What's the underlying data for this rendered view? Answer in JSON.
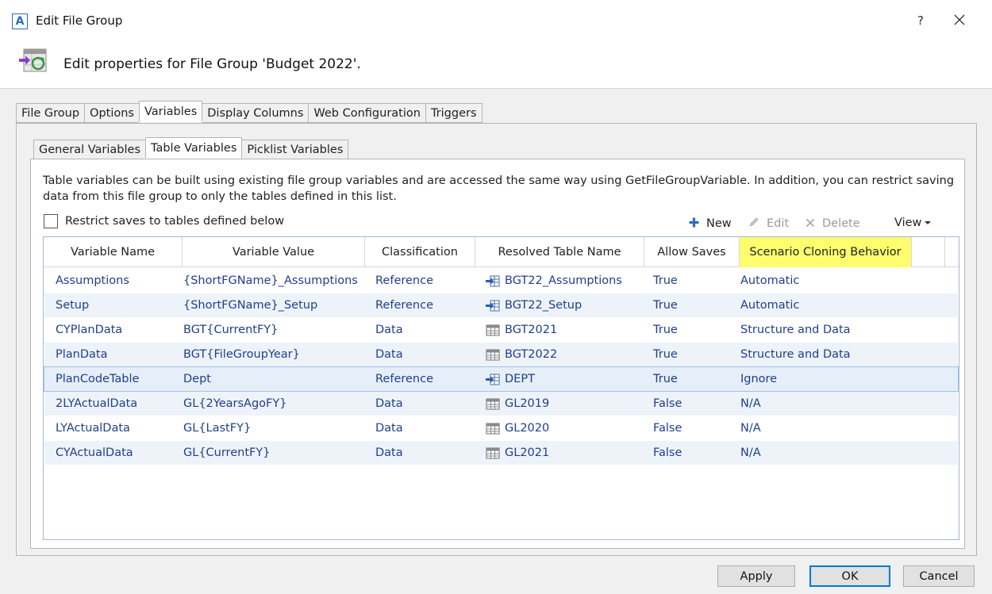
{
  "window": {
    "title": "Edit File Group",
    "app_icon_letter": "A",
    "help_label": "?"
  },
  "header": {
    "text": "Edit properties for File Group 'Budget 2022'."
  },
  "tabs": [
    {
      "label": "File Group",
      "active": false
    },
    {
      "label": "Options",
      "active": false
    },
    {
      "label": "Variables",
      "active": true
    },
    {
      "label": "Display Columns",
      "active": false
    },
    {
      "label": "Web Configuration",
      "active": false
    },
    {
      "label": "Triggers",
      "active": false
    }
  ],
  "subtabs": [
    {
      "label": "General Variables",
      "active": false
    },
    {
      "label": "Table Variables",
      "active": true
    },
    {
      "label": "Picklist Variables",
      "active": false
    }
  ],
  "description": "Table variables can be built using existing file group variables and are accessed the same way using GetFileGroupVariable. In addition, you can restrict saving data from this file group to only the tables defined in this list.",
  "restrict_label": "Restrict saves to tables defined below",
  "restrict_checked": false,
  "toolbar": {
    "new_label": "New",
    "edit_label": "Edit",
    "delete_label": "Delete",
    "view_label": "View"
  },
  "grid": {
    "columns": [
      "Variable Name",
      "Variable Value",
      "Classification",
      "Resolved Table Name",
      "Allow Saves",
      "Scenario Cloning Behavior"
    ],
    "highlight_column_color": "#fdfd6e",
    "rows": [
      {
        "name": "Assumptions",
        "value": "{ShortFGName}_Assumptions",
        "classification": "Reference",
        "table_icon": "reference-table-icon",
        "table": "BGT22_Assumptions",
        "allow": "True",
        "cloning": "Automatic"
      },
      {
        "name": "Setup",
        "value": "{ShortFGName}_Setup",
        "classification": "Reference",
        "table_icon": "reference-table-icon",
        "table": "BGT22_Setup",
        "allow": "True",
        "cloning": "Automatic"
      },
      {
        "name": "CYPlanData",
        "value": "BGT{CurrentFY}",
        "classification": "Data",
        "table_icon": "data-table-icon",
        "table": "BGT2021",
        "allow": "True",
        "cloning": "Structure and Data"
      },
      {
        "name": "PlanData",
        "value": "BGT{FileGroupYear}",
        "classification": "Data",
        "table_icon": "data-table-icon",
        "table": "BGT2022",
        "allow": "True",
        "cloning": "Structure and Data"
      },
      {
        "name": "PlanCodeTable",
        "value": "Dept",
        "classification": "Reference",
        "table_icon": "reference-table-icon",
        "table": "DEPT",
        "allow": "True",
        "cloning": "Ignore"
      },
      {
        "name": "2LYActualData",
        "value": "GL{2YearsAgoFY}",
        "classification": "Data",
        "table_icon": "data-table-icon",
        "table": "GL2019",
        "allow": "False",
        "cloning": "N/A"
      },
      {
        "name": "LYActualData",
        "value": "GL{LastFY}",
        "classification": "Data",
        "table_icon": "data-table-icon",
        "table": "GL2020",
        "allow": "False",
        "cloning": "N/A"
      },
      {
        "name": "CYActualData",
        "value": "GL{CurrentFY}",
        "classification": "Data",
        "table_icon": "data-table-icon",
        "table": "GL2021",
        "allow": "False",
        "cloning": "N/A"
      }
    ]
  },
  "buttons": {
    "apply": "Apply",
    "ok": "OK",
    "cancel": "Cancel"
  },
  "colors": {
    "grid_text": "#1f3f8c",
    "alt_row": "#eef3fa",
    "accent": "#0078d7"
  }
}
